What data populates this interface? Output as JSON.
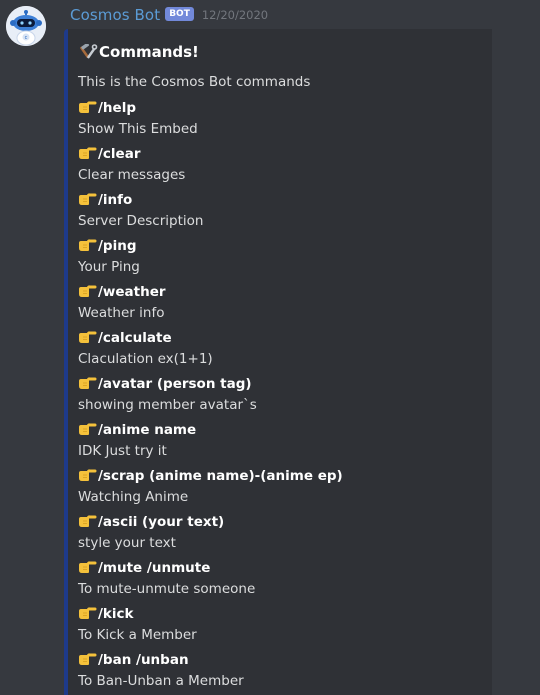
{
  "author": {
    "name": "Cosmos Bot",
    "tag": "BOT",
    "timestamp": "12/20/2020"
  },
  "embed": {
    "title": "Commands!",
    "description": "This is the Cosmos Bot commands",
    "accent_color": "#1e3a8a",
    "title_icon": "hammer-wrench-icon",
    "field_icon": "pointing-hand-icon",
    "fields": [
      {
        "name": "/help",
        "value": "Show This Embed"
      },
      {
        "name": "/clear",
        "value": "Clear messages"
      },
      {
        "name": "/info",
        "value": "Server Description"
      },
      {
        "name": "/ping",
        "value": "Your Ping"
      },
      {
        "name": "/weather",
        "value": "Weather info"
      },
      {
        "name": "/calculate",
        "value": "Claculation ex(1+1)"
      },
      {
        "name": "/avatar (person tag)",
        "value": "showing member avatar`s"
      },
      {
        "name": "/anime name",
        "value": "IDK Just try it"
      },
      {
        "name": "/scrap (anime name)-(anime ep)",
        "value": "Watching Anime"
      },
      {
        "name": "/ascii (your text)",
        "value": "style your text"
      },
      {
        "name": "/mute /unmute",
        "value": "To mute-unmute someone"
      },
      {
        "name": "/kick",
        "value": "To Kick a Member"
      },
      {
        "name": "/ban /unban",
        "value": "To Ban-Unban a Member"
      }
    ]
  },
  "colors": {
    "background": "#36393f",
    "embed_background": "#2f3136",
    "username": "#5b9bd5",
    "bot_tag": "#7289da",
    "timestamp": "#72767d"
  }
}
